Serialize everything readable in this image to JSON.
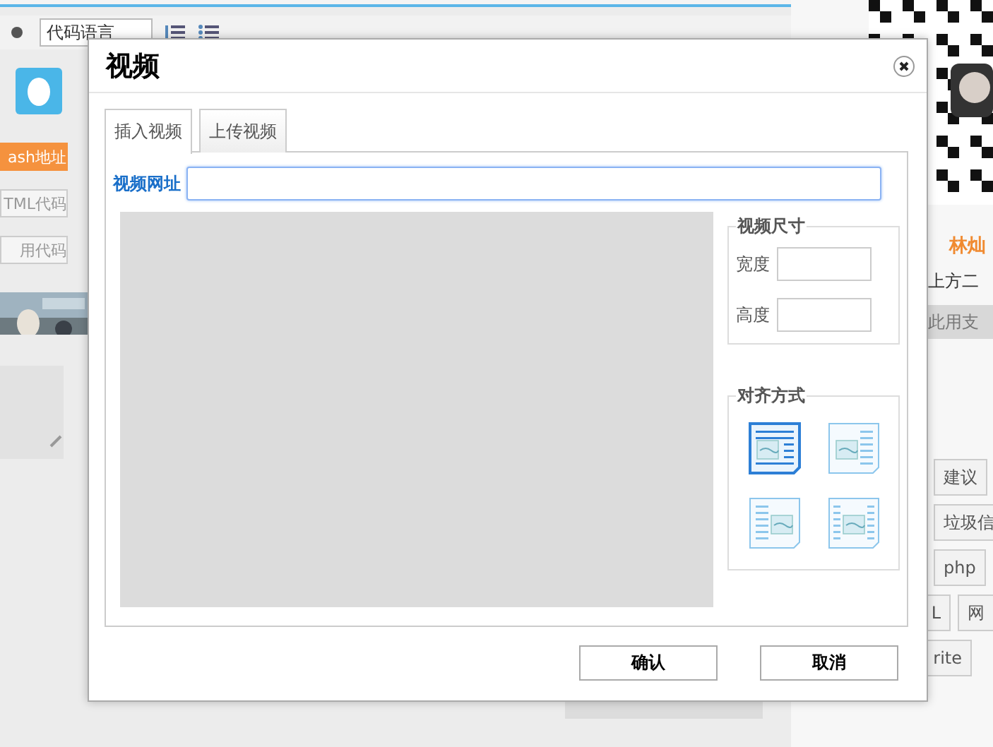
{
  "background": {
    "toolbar": {
      "language_select": "代码语言"
    },
    "side_buttons": [
      {
        "label": "ash地址",
        "selected": true
      },
      {
        "label": "TML代码",
        "selected": false
      },
      {
        "label": "用代码",
        "selected": false
      }
    ],
    "profile": {
      "name": "林灿",
      "caption": "上方二",
      "note": "此用支"
    },
    "tags": [
      {
        "label": "建议"
      },
      {
        "label": "垃圾信"
      },
      {
        "label": "php"
      },
      {
        "label": "L"
      },
      {
        "label": "网"
      },
      {
        "label": "rite"
      }
    ]
  },
  "dialog": {
    "title": "视频",
    "tabs": [
      {
        "label": "插入视频",
        "selected": true
      },
      {
        "label": "上传视频",
        "selected": false
      }
    ],
    "url_label": "视频网址",
    "size_group": {
      "legend": "视频尺寸",
      "fields": [
        {
          "label": "宽度"
        },
        {
          "label": "高度"
        }
      ]
    },
    "align_group": {
      "legend": "对齐方式",
      "options": [
        {
          "kind": "block",
          "selected": true
        },
        {
          "kind": "left",
          "selected": false
        },
        {
          "kind": "right",
          "selected": false
        },
        {
          "kind": "center",
          "selected": false
        }
      ]
    },
    "buttons": [
      "确认",
      "取消"
    ]
  }
}
